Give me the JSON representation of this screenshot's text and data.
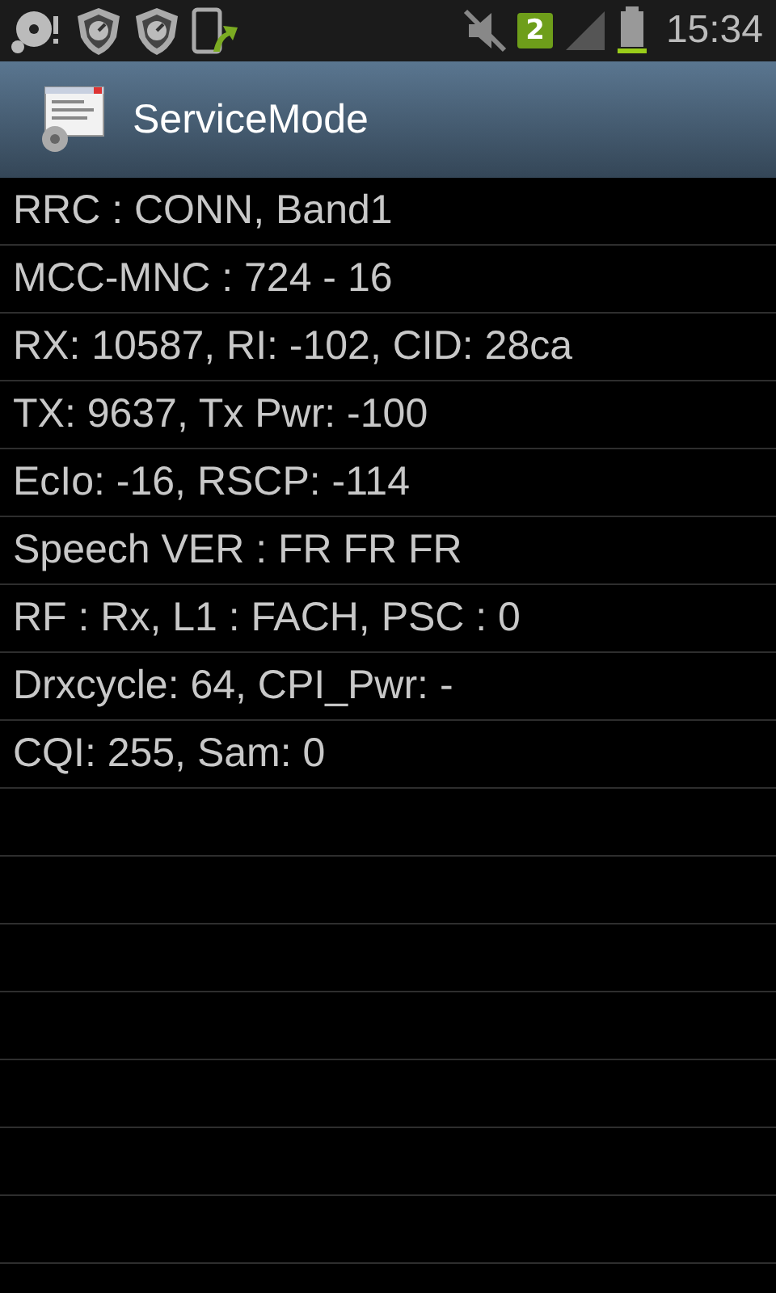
{
  "status_bar": {
    "sim_badge": "2",
    "time": "15:34"
  },
  "action_bar": {
    "title": "ServiceMode"
  },
  "lines": [
    "RRC : CONN, Band1",
    "MCC-MNC : 724 - 16",
    "RX: 10587, RI: -102, CID: 28ca",
    "TX: 9637, Tx Pwr: -100",
    "EcIo: -16, RSCP: -114",
    "Speech VER : FR FR FR",
    "RF : Rx, L1 : FACH, PSC : 0",
    "Drxcycle: 64, CPI_Pwr: -",
    "CQI: 255, Sam: 0"
  ]
}
